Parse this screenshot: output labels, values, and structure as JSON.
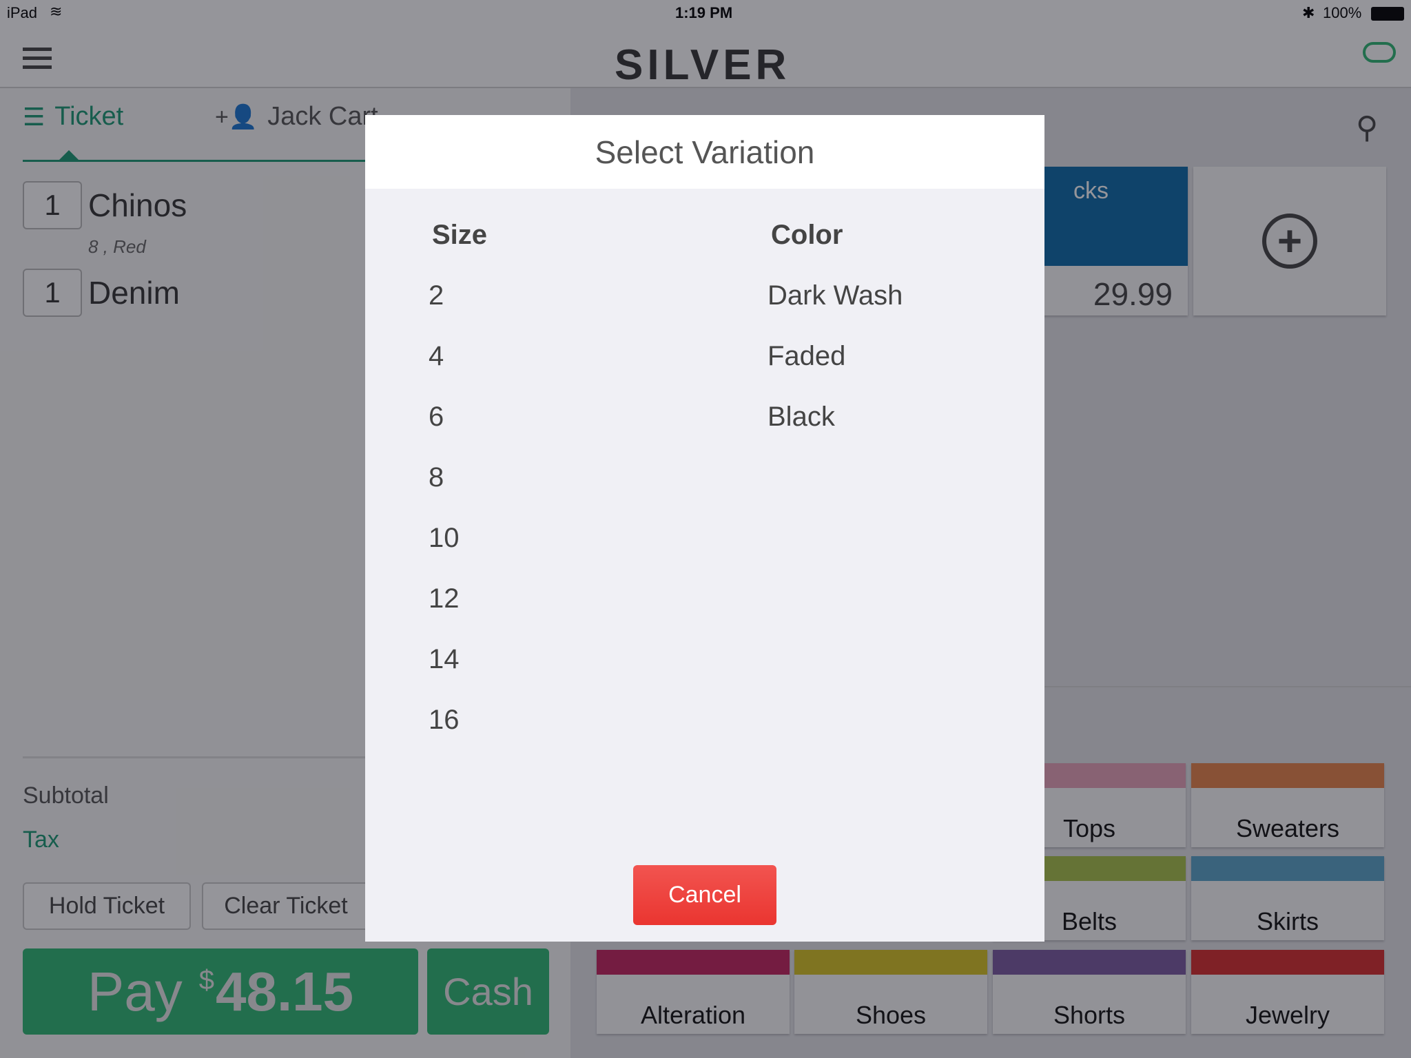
{
  "status_bar": {
    "device": "iPad",
    "time": "1:19 PM",
    "battery": "100%"
  },
  "header": {
    "logo": "SILVER"
  },
  "tabs": [
    {
      "label": "Ticket",
      "icon": "list-icon"
    },
    {
      "label": "Jack Cart",
      "icon": "add-person-icon"
    }
  ],
  "ticket": {
    "items": [
      {
        "qty": "1",
        "name": "Chinos",
        "variant": "8 , Red"
      },
      {
        "qty": "1",
        "name": "Denim",
        "variant": ""
      }
    ],
    "subtotal_label": "Subtotal",
    "tax_label": "Tax",
    "hold_label": "Hold Ticket",
    "clear_label": "Clear Ticket",
    "pay_label": "Pay",
    "pay_currency": "$",
    "pay_amount": "48.15",
    "cash_label": "Cash"
  },
  "products": {
    "partial_name": "cks",
    "price": "29.99"
  },
  "categories": [
    {
      "label": "Tops",
      "color": "#e8a2b8"
    },
    {
      "label": "Sweaters",
      "color": "#e8844a"
    },
    {
      "label": "Belts",
      "color": "#a8c24a"
    },
    {
      "label": "Skirts",
      "color": "#5aa4c8"
    },
    {
      "label": "Alteration",
      "color": "#c4245e"
    },
    {
      "label": "Shoes",
      "color": "#d8c424"
    },
    {
      "label": "Shorts",
      "color": "#7a5aa0"
    },
    {
      "label": "Jewelry",
      "color": "#d82c2c"
    }
  ],
  "modal": {
    "title": "Select Variation",
    "size_header": "Size",
    "color_header": "Color",
    "sizes": [
      "2",
      "4",
      "6",
      "8",
      "10",
      "12",
      "14",
      "16"
    ],
    "colors": [
      "Dark Wash",
      "Faded",
      "Black"
    ],
    "cancel_label": "Cancel"
  },
  "colors": {
    "accent": "#1a9a74",
    "pay": "#2eb873",
    "cancel": "#ee3e3a"
  }
}
